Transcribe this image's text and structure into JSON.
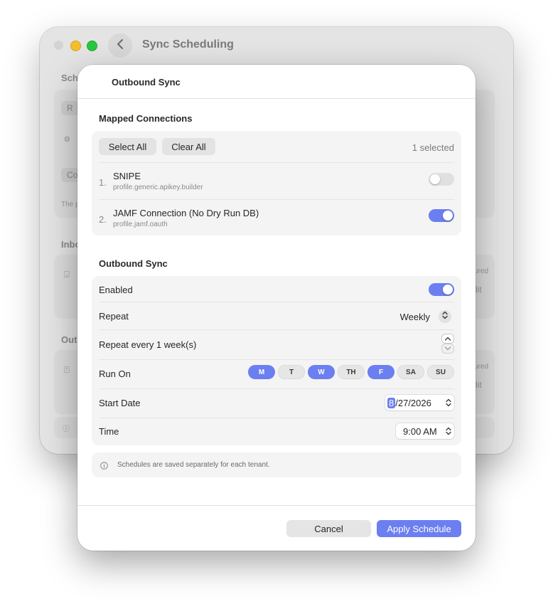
{
  "background_window": {
    "title": "Sync Scheduling",
    "labels": [
      "Sche",
      "Inbo",
      "Out"
    ],
    "partial_texts": [
      "R",
      "Co",
      "The p",
      "ured",
      "lit",
      "ured",
      "lit"
    ]
  },
  "sheet": {
    "title": "Outbound Sync",
    "mapped": {
      "section_title": "Mapped Connections",
      "select_all": "Select All",
      "clear_all": "Clear All",
      "selected_count": "1 selected",
      "connections": [
        {
          "index": "1.",
          "name": "SNIPE",
          "profile": "profile.generic.apikey.builder",
          "enabled": false
        },
        {
          "index": "2.",
          "name": "JAMF Connection (No Dry Run DB)",
          "profile": "profile.jamf.oauth",
          "enabled": true
        }
      ]
    },
    "outbound": {
      "section_title": "Outbound Sync",
      "enabled_label": "Enabled",
      "enabled": true,
      "repeat_label": "Repeat",
      "repeat_value": "Weekly",
      "repeat_every_label": "Repeat every 1 week(s)",
      "run_on_label": "Run On",
      "days": [
        {
          "label": "M",
          "on": true
        },
        {
          "label": "T",
          "on": false
        },
        {
          "label": "W",
          "on": true
        },
        {
          "label": "TH",
          "on": false
        },
        {
          "label": "F",
          "on": true
        },
        {
          "label": "SA",
          "on": false
        },
        {
          "label": "SU",
          "on": false
        }
      ],
      "start_date_label": "Start Date",
      "start_date_month": "8",
      "start_date_rest": "/27/2026",
      "time_label": "Time",
      "time_value": "9:00 AM"
    },
    "info_text": "Schedules are saved separately for each tenant.",
    "cancel_label": "Cancel",
    "apply_label": "Apply Schedule"
  },
  "colors": {
    "accent": "#6b7ff0",
    "toggle_off": "#e0e0e0"
  }
}
